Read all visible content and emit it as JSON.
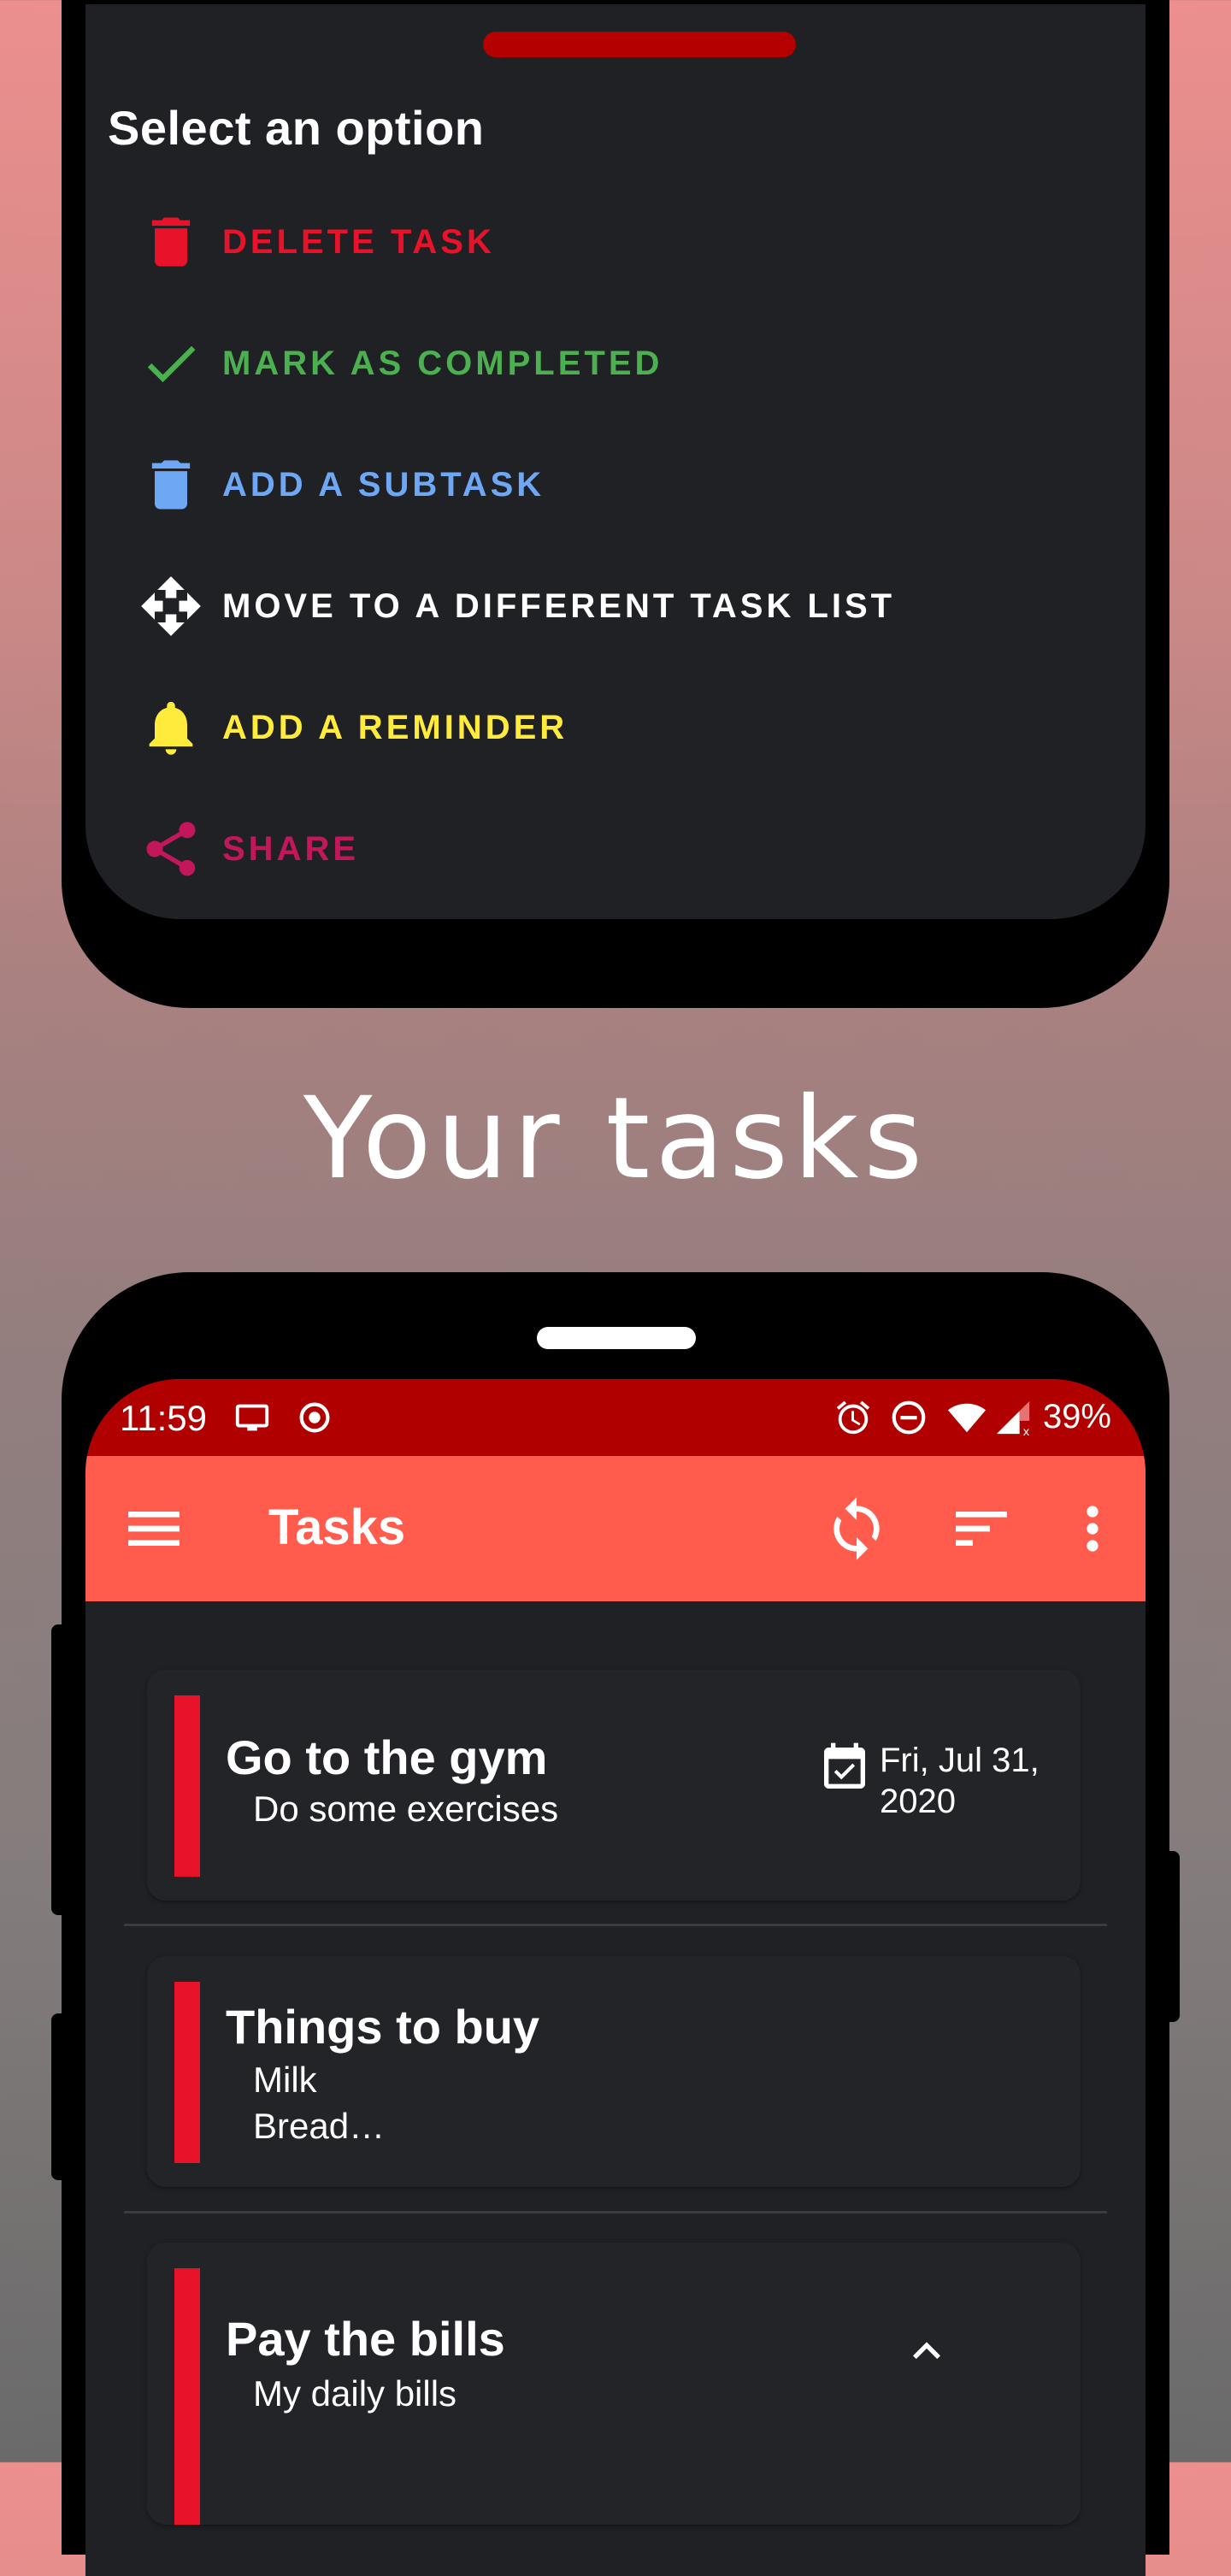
{
  "options_sheet": {
    "title": "Select an option",
    "options": [
      {
        "label": "DELETE TASK",
        "icon": "trash-icon",
        "color": "#e8132a"
      },
      {
        "label": "MARK AS COMPLETED",
        "icon": "check-icon",
        "color": "#4caf50"
      },
      {
        "label": "ADD A SUBTASK",
        "icon": "trash-icon",
        "color": "#6ea8f5"
      },
      {
        "label": "MOVE TO A DIFFERENT TASK LIST",
        "icon": "move-icon",
        "color": "#ffffff"
      },
      {
        "label": "ADD A REMINDER",
        "icon": "bell-icon",
        "color": "#ffeb3b"
      },
      {
        "label": "SHARE",
        "icon": "share-icon",
        "color": "#c2185b"
      }
    ]
  },
  "headline": "Your tasks",
  "status_bar": {
    "time": "11:59",
    "battery": "39%"
  },
  "toolbar": {
    "title": "Tasks"
  },
  "tasks": [
    {
      "title": "Go to the gym",
      "description": "Do some exercises",
      "due_line1": "Fri, Jul 31,",
      "due_line2": "2020"
    },
    {
      "title": "Things to buy",
      "description_line1": "Milk",
      "description_line2": "Bread…"
    },
    {
      "title": "Pay the bills",
      "description": "My daily bills"
    }
  ],
  "colors": {
    "accent": "#ff5c4d",
    "status_bar": "#b10000",
    "task_marker": "#e8132a",
    "surface": "#202125"
  }
}
